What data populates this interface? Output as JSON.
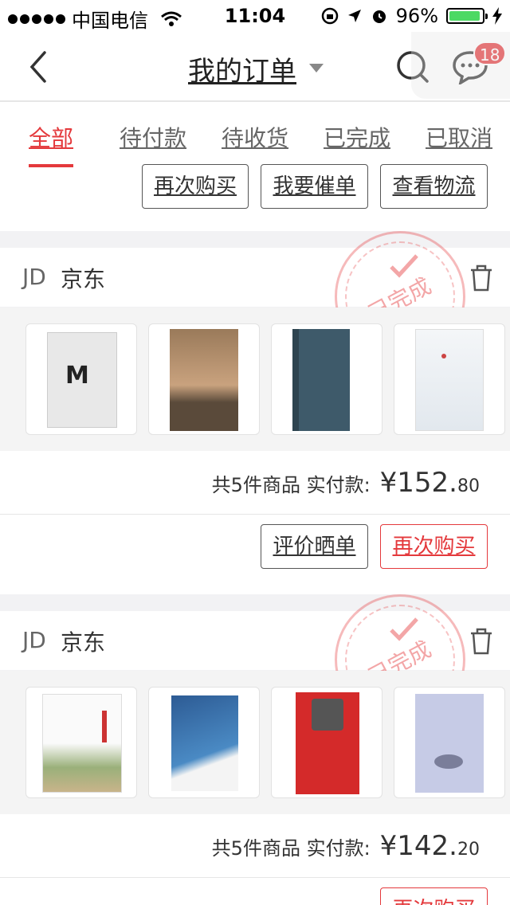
{
  "status_bar": {
    "carrier": "中国电信",
    "time": "11:04",
    "battery": "96%",
    "battery_level": 0.96
  },
  "nav": {
    "title": "我的订单",
    "message_badge": "18"
  },
  "tabs": [
    {
      "label": "全部",
      "active": true
    },
    {
      "label": "待付款",
      "active": false
    },
    {
      "label": "待收货",
      "active": false
    },
    {
      "label": "已完成",
      "active": false
    },
    {
      "label": "已取消",
      "active": false
    }
  ],
  "top_actions": {
    "buy_again": "再次购买",
    "urge": "我要催单",
    "logistics": "查看物流"
  },
  "orders": [
    {
      "shop_logo": "JD",
      "shop_name": "京东",
      "stamp": "已完成",
      "summary_label": "共5件商品  实付款:",
      "price_int": "¥152.",
      "price_dec": "80",
      "actions": {
        "review": "评价晒单",
        "buy_again": "再次购买"
      }
    },
    {
      "shop_logo": "JD",
      "shop_name": "京东",
      "stamp": "已完成",
      "summary_label": "共5件商品  实付款:",
      "price_int": "¥142.",
      "price_dec": "20",
      "actions": {
        "buy_again": "再次购买"
      }
    }
  ],
  "colors": {
    "accent": "#e4393c",
    "background": "#f2f2f4"
  }
}
